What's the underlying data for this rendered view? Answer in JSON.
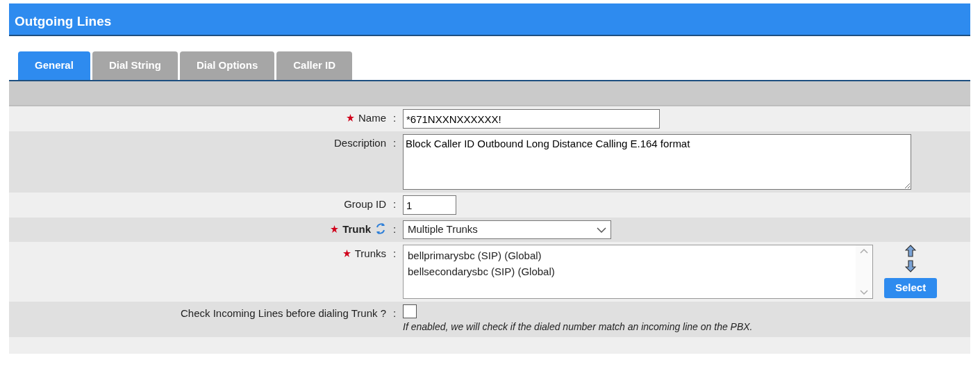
{
  "header": {
    "title": "Outgoing Lines"
  },
  "tabs": [
    {
      "label": "General",
      "selected": true
    },
    {
      "label": "Dial String",
      "selected": false
    },
    {
      "label": "Dial Options",
      "selected": false
    },
    {
      "label": "Caller ID",
      "selected": false
    }
  ],
  "fields": [
    {
      "kind": "text",
      "label": "Name",
      "required": true,
      "separator": ":",
      "value": "*671NXXNXXXXXX!"
    },
    {
      "kind": "textarea",
      "label": "Description",
      "required": false,
      "separator": ":",
      "value": "Block Caller ID Outbound Long Distance Calling E.164 format"
    },
    {
      "kind": "short",
      "label": "Group ID",
      "required": false,
      "separator": ":",
      "value": "1"
    },
    {
      "kind": "select",
      "label": "Trunk",
      "required": true,
      "separator": ":",
      "value": "Multiple Trunks"
    },
    {
      "kind": "listbox",
      "label": "Trunks",
      "required": true,
      "separator": ":",
      "items": [
        "bellprimarysbc (SIP) (Global)",
        "bellsecondarysbc (SIP) (Global)"
      ],
      "button": "Select"
    },
    {
      "kind": "checkbox",
      "label": "Check Incoming Lines before dialing Trunk ?",
      "required": false,
      "separator": ":",
      "checked": false,
      "hint": "If enabled, we will check if the dialed number match an incoming line on the PBX."
    }
  ]
}
